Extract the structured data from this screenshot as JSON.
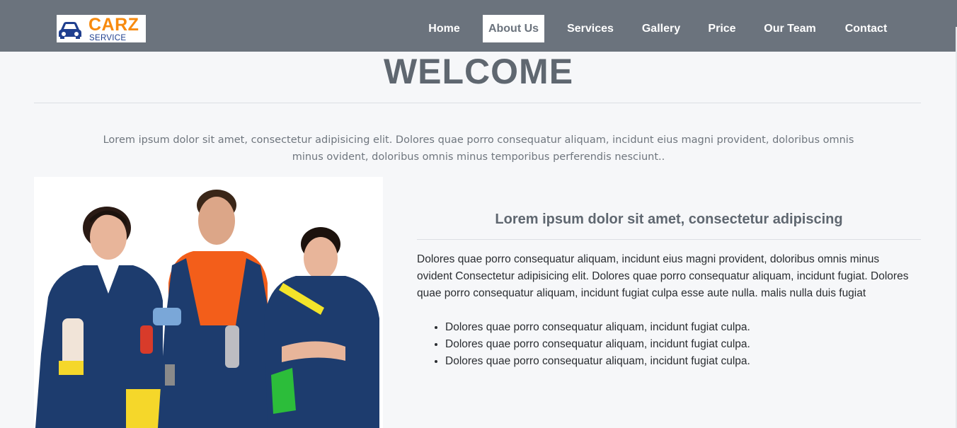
{
  "logo": {
    "brand": "CARZ",
    "sub": "SERVICE",
    "icon": "car-icon",
    "colors": {
      "brand": "#f78a0e",
      "sub": "#1f3f8f",
      "car": "#1f3f8f"
    }
  },
  "nav": {
    "items": [
      {
        "label": "Home",
        "active": false
      },
      {
        "label": "About Us",
        "active": true
      },
      {
        "label": "Services",
        "active": false
      },
      {
        "label": "Gallery",
        "active": false
      },
      {
        "label": "Price",
        "active": false
      },
      {
        "label": "Our Team",
        "active": false
      },
      {
        "label": "Contact",
        "active": false
      }
    ],
    "colors": {
      "bar": "#6b737d",
      "active_bg": "#ffffff"
    }
  },
  "main": {
    "heading": "WELCOME",
    "intro": "Lorem ipsum dolor sit amet, consectetur adipisicing elit. Dolores quae porro consequatur aliquam, incidunt eius magni provident, doloribus omnis minus ovident, doloribus omnis minus temporibus perferendis nesciunt..",
    "section_title": "Lorem ipsum dolor sit amet, consectetur adipiscing",
    "paragraph": "Dolores quae porro consequatur aliquam, incidunt eius magni provident, doloribus omnis minus ovident Consectetur adipisicing elit. Dolores quae porro consequatur aliquam, incidunt fugiat. Dolores quae porro consequatur aliquam, incidunt fugiat culpa esse aute nulla. malis nulla duis fugiat",
    "bullets": [
      "Dolores quae porro consequatur aliquam, incidunt fugiat culpa.",
      "Dolores quae porro consequatur aliquam, incidunt fugiat culpa.",
      "Dolores quae porro consequatur aliquam, incidunt fugiat culpa."
    ],
    "photo": "team-photo-image"
  }
}
